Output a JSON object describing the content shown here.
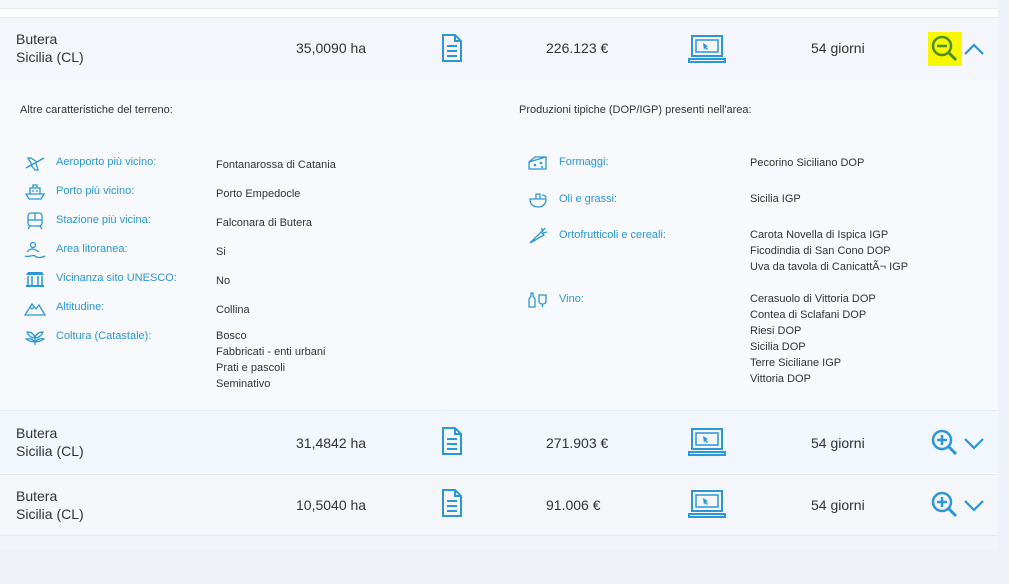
{
  "listings": [
    {
      "loc_line1": "Butera",
      "loc_line2": "Sicilia (CL)",
      "area": "35,0090 ha",
      "price": "226.123 €",
      "days": "54 giorni",
      "expanded": true
    },
    {
      "loc_line1": "Butera",
      "loc_line2": "Sicilia (CL)",
      "area": "31,4842 ha",
      "price": "271.903 €",
      "days": "54 giorni",
      "expanded": false
    },
    {
      "loc_line1": "Butera",
      "loc_line2": "Sicilia (CL)",
      "area": "10,5040 ha",
      "price": "91.006 €",
      "days": "54 giorni",
      "expanded": false
    }
  ],
  "details": {
    "left_heading": "Altre caratteristiche del terreno:",
    "right_heading": "Produzioni tipiche (DOP/IGP) presenti nell'area:",
    "features": [
      {
        "icon": "airplane-icon",
        "label": "Aeroporto più vicino:",
        "value": "Fontanarossa di Catania"
      },
      {
        "icon": "ship-icon",
        "label": "Porto più vicino:",
        "value": "Porto Empedocle"
      },
      {
        "icon": "train-icon",
        "label": "Stazione più vicina:",
        "value": "Falconara di Butera"
      },
      {
        "icon": "beach-icon",
        "label": "Area litoranea:",
        "value": "Si"
      },
      {
        "icon": "temple-icon",
        "label": "Vicinanza sito UNESCO:",
        "value": "No"
      },
      {
        "icon": "mountain-icon",
        "label": "Altitudine:",
        "value": "Collina"
      },
      {
        "icon": "plant-icon",
        "label": "Coltura (Catastale):",
        "values": [
          "Bosco",
          "Fabbricati - enti urbani",
          "Prati e pascoli",
          "Seminativo"
        ]
      }
    ],
    "products": [
      {
        "icon": "cheese-icon",
        "label": "Formaggi:",
        "values": [
          "Pecorino Siciliano DOP"
        ]
      },
      {
        "icon": "oil-icon",
        "label": "Oli e grassi:",
        "values": [
          "Sicilia IGP"
        ]
      },
      {
        "icon": "carrot-icon",
        "label": "Ortofrutticoli e cereali:",
        "values": [
          "Carota Novella di Ispica IGP",
          "Ficodindia di San Cono DOP",
          "Uva da tavola di CanicattÃ¬ IGP"
        ]
      },
      {
        "icon": "wine-icon",
        "label": "Vino:",
        "values": [
          "Cerasuolo di Vittoria DOP",
          "Contea di Sclafani DOP",
          "Riesi DOP",
          "Sicilia DOP",
          "Terre Siciliane IGP",
          "Vittoria DOP"
        ]
      }
    ]
  },
  "colors": {
    "accent": "#2c97d4",
    "highlight": "#f6f700",
    "zoom_active": "#4a8f1f"
  }
}
